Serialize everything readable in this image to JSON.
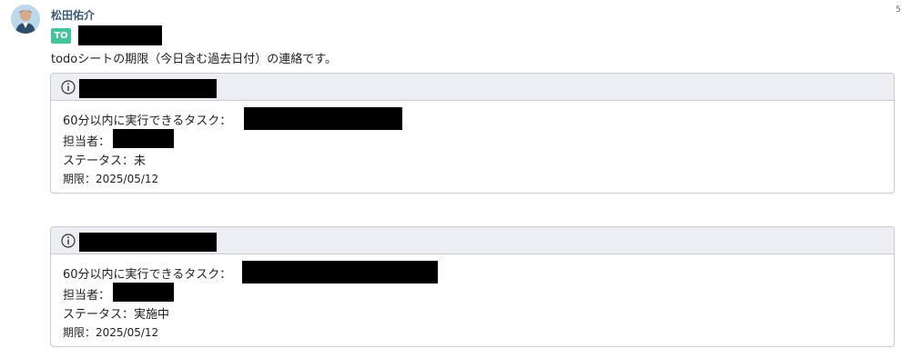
{
  "message": {
    "sender_name": "松田佑介",
    "corner_text": "5",
    "to_badge": "TO",
    "body_text": "todoシートの期限（今日含む過去日付）の連絡です。"
  },
  "cards": [
    {
      "icon": "info-icon",
      "task_label": "60分以内に実行できるタスク：",
      "assignee_label": "担当者：",
      "status_text": "ステータス：未",
      "deadline_text": "期限：2025/05/12"
    },
    {
      "icon": "info-icon",
      "task_label": "60分以内に実行できるタスク：",
      "assignee_label": "担当者：",
      "status_text": "ステータス：実施中",
      "deadline_text": "期限：2025/05/12"
    }
  ],
  "colors": {
    "sender": "#3c5a78",
    "to_badge_bg": "#45c39a",
    "card_header_bg": "#eceef4",
    "card_border": "#cccccc"
  }
}
